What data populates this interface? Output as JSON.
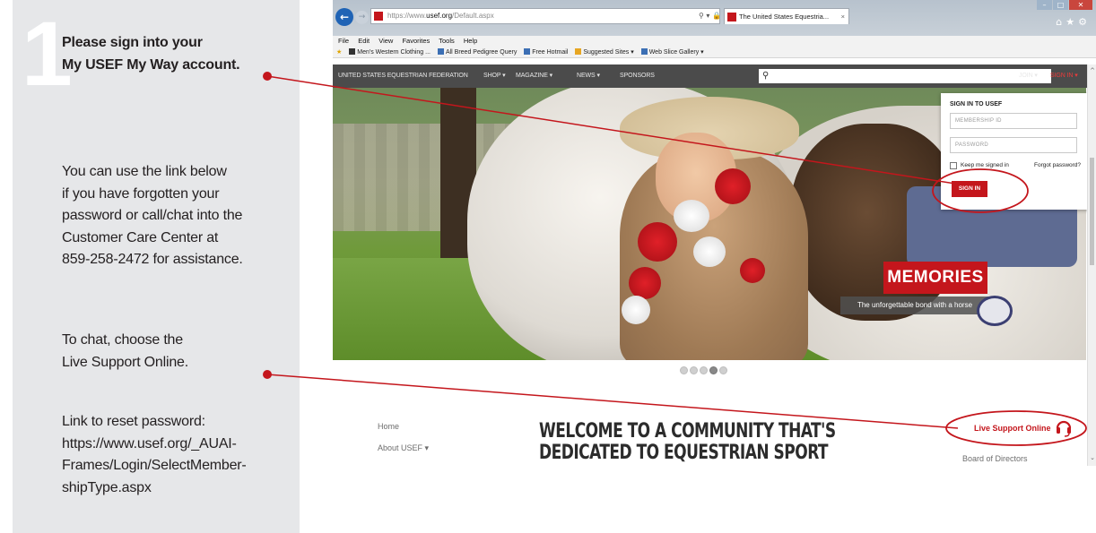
{
  "panel": {
    "step_number": "1",
    "heading": [
      "Please sign into your",
      "My USEF My Way account."
    ],
    "help_text": [
      "You can use the link below",
      "if you have forgotten your",
      "password or call/chat into the",
      "Customer Care Center at",
      "859-258-2472 for assistance."
    ],
    "chat_text": [
      "To chat, choose the",
      "Live Support Online."
    ],
    "reset_text": [
      "Link to reset password:",
      "https://www.usef.org/_AUAI-",
      "Frames/Login/SelectMember-",
      "shipType.aspx"
    ]
  },
  "browser": {
    "address": {
      "prefix": "https://www.",
      "domain": "usef.org",
      "path": "/Default.aspx"
    },
    "tab_title": "The United States Equestria...",
    "menu": [
      "File",
      "Edit",
      "View",
      "Favorites",
      "Tools",
      "Help"
    ],
    "favorites": [
      "Men's Western Clothing ...",
      "All Breed Pedigree Query",
      "Free Hotmail",
      "Suggested Sites ▾",
      "Web Slice Gallery ▾"
    ]
  },
  "site": {
    "nav": [
      "UNITED STATES EQUESTRIAN FEDERATION",
      "SHOP ▾",
      "MAGAZINE ▾",
      "NEWS ▾",
      "SPONSORS"
    ],
    "join": "JOIN ▾",
    "signin": "SIGN IN ▾",
    "signin_box": {
      "title": "SIGN IN TO USEF",
      "membership_placeholder": "MEMBERSHIP ID",
      "password_placeholder": "PASSWORD",
      "keep_signed": "Keep me signed in",
      "forgot": "Forgot password?",
      "button": "SIGN IN"
    },
    "slide_title": "MEMORIES",
    "slide_caption": "The unforgettable bond with a horse",
    "carousel_active": 4,
    "leftnav": [
      "Home",
      "About USEF ▾"
    ],
    "welcome": [
      "WELCOME TO A COMMUNITY THAT'S",
      "DEDICATED TO EQUESTRIAN SPORT"
    ],
    "live_support": "Live Support Online",
    "board": "Board of Directors"
  },
  "colors": {
    "accent": "#c4161c",
    "panel": "#e6e7e9",
    "nav": "#4b4b4b"
  }
}
